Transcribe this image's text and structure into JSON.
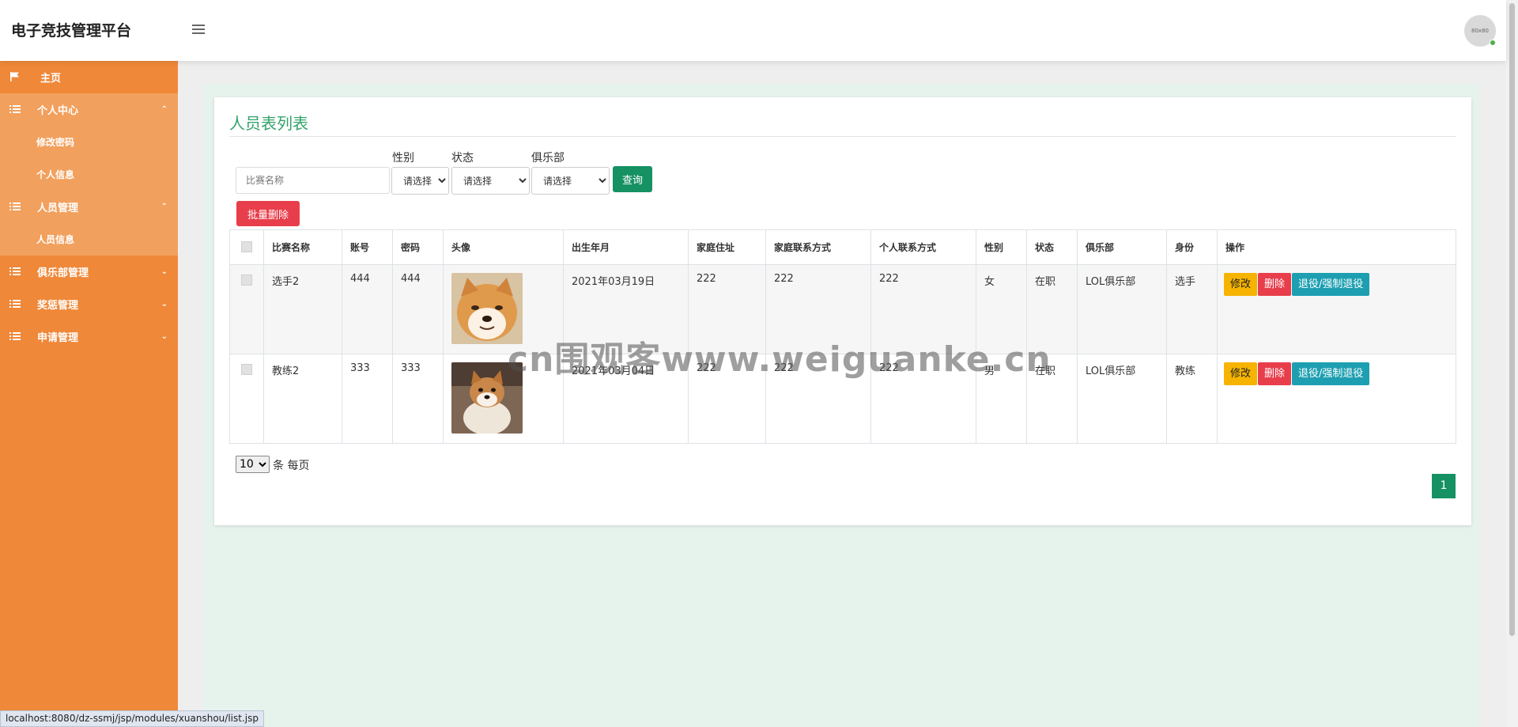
{
  "header": {
    "brand": "电子竞技管理平台",
    "avatar_text": "80x80"
  },
  "sidebar": {
    "home": "主页",
    "personal_center": "个人中心",
    "change_password": "修改密码",
    "personal_info": "个人信息",
    "staff_management": "人员管理",
    "staff_info": "人员信息",
    "club_management": "俱乐部管理",
    "reward_management": "奖惩管理",
    "application_management": "申请管理"
  },
  "page": {
    "title": "人员表列表",
    "search_placeholder": "比赛名称",
    "filters": {
      "gender_label": "性别",
      "status_label": "状态",
      "club_label": "俱乐部",
      "select_placeholder": "请选择"
    },
    "search_button": "查询",
    "batch_delete_button": "批量删除"
  },
  "table": {
    "headers": [
      "比赛名称",
      "账号",
      "密码",
      "头像",
      "出生年月",
      "家庭住址",
      "家庭联系方式",
      "个人联系方式",
      "性别",
      "状态",
      "俱乐部",
      "身份",
      "操作"
    ],
    "rows": [
      {
        "name": "选手2",
        "account": "444",
        "password": "444",
        "birth": "2021年03月19日",
        "address": "222",
        "home_phone": "222",
        "personal_phone": "222",
        "gender": "女",
        "status": "在职",
        "club": "LOL俱乐部",
        "identity": "选手"
      },
      {
        "name": "教练2",
        "account": "333",
        "password": "333",
        "birth": "2021年03月04日",
        "address": "222",
        "home_phone": "222",
        "personal_phone": "222",
        "gender": "男",
        "status": "在职",
        "club": "LOL俱乐部",
        "identity": "教练"
      }
    ],
    "actions": {
      "edit": "修改",
      "delete": "删除",
      "retire": "退役/强制退役"
    }
  },
  "pagination": {
    "page_size": "10",
    "page_size_suffix": "条 每页",
    "current_page": "1"
  },
  "watermark": "cn围观客www.weiguanke.cn",
  "status_bar": "localhost:8080/dz-ssmj/jsp/modules/xuanshou/list.jsp",
  "colors": {
    "sidebar": "#ef8839",
    "accent_green": "#169164",
    "title_green": "#33a36a",
    "danger": "#e83e4b",
    "warning": "#f6b400",
    "info": "#1d9fb1"
  }
}
